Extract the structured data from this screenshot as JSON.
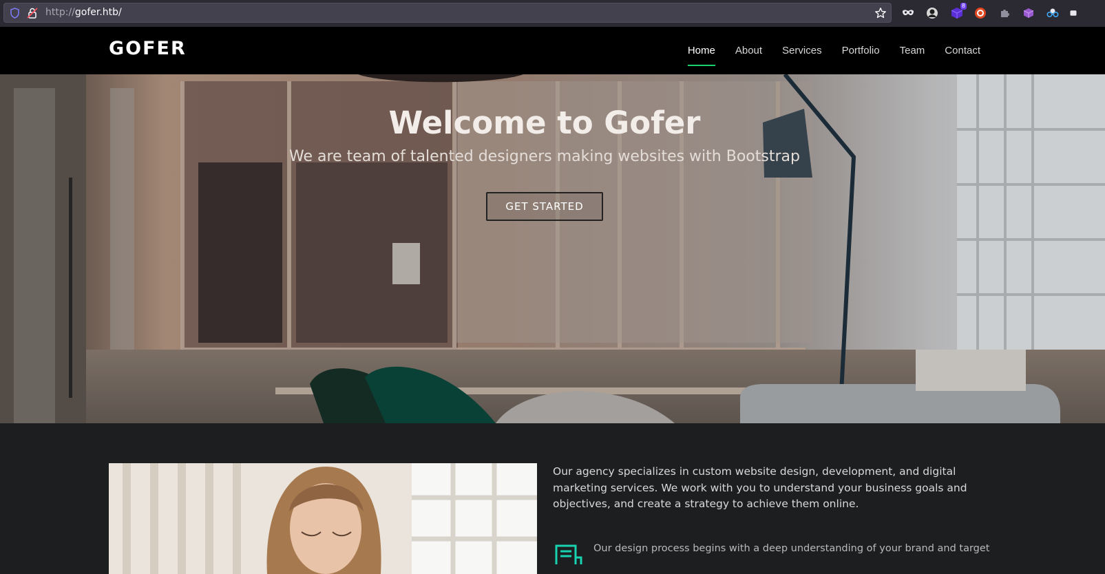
{
  "browser": {
    "url_scheme": "http://",
    "url_host": "gofer.htb/",
    "icons": {
      "shield": "shield-icon",
      "lock": "insecure-lock-icon",
      "bookmark": "star-icon"
    },
    "extensions": [
      {
        "name": "mask-extension-icon"
      },
      {
        "name": "profile-extension-icon"
      },
      {
        "name": "cube-extension-icon",
        "badge": "8"
      },
      {
        "name": "duckduckgo-extension-icon"
      },
      {
        "name": "puzzle-extension-icon"
      },
      {
        "name": "purple-cube-extension-icon"
      },
      {
        "name": "glasses-extension-icon"
      }
    ]
  },
  "site": {
    "logo": "GOFER",
    "nav": [
      "Home",
      "About",
      "Services",
      "Portfolio",
      "Team",
      "Contact"
    ],
    "active_nav": "Home",
    "accent_color": "#18d26e"
  },
  "hero": {
    "title": "Welcome to Gofer",
    "subtitle": "We are team of talented designers making websites with Bootstrap",
    "cta": "GET STARTED"
  },
  "about": {
    "paragraph1": "Our agency specializes in custom website design, development, and digital marketing services. We work with you to understand your business goals and objectives, and create a strategy to achieve them online.",
    "paragraph2": "Our design process begins with a deep understanding of your brand and target"
  }
}
